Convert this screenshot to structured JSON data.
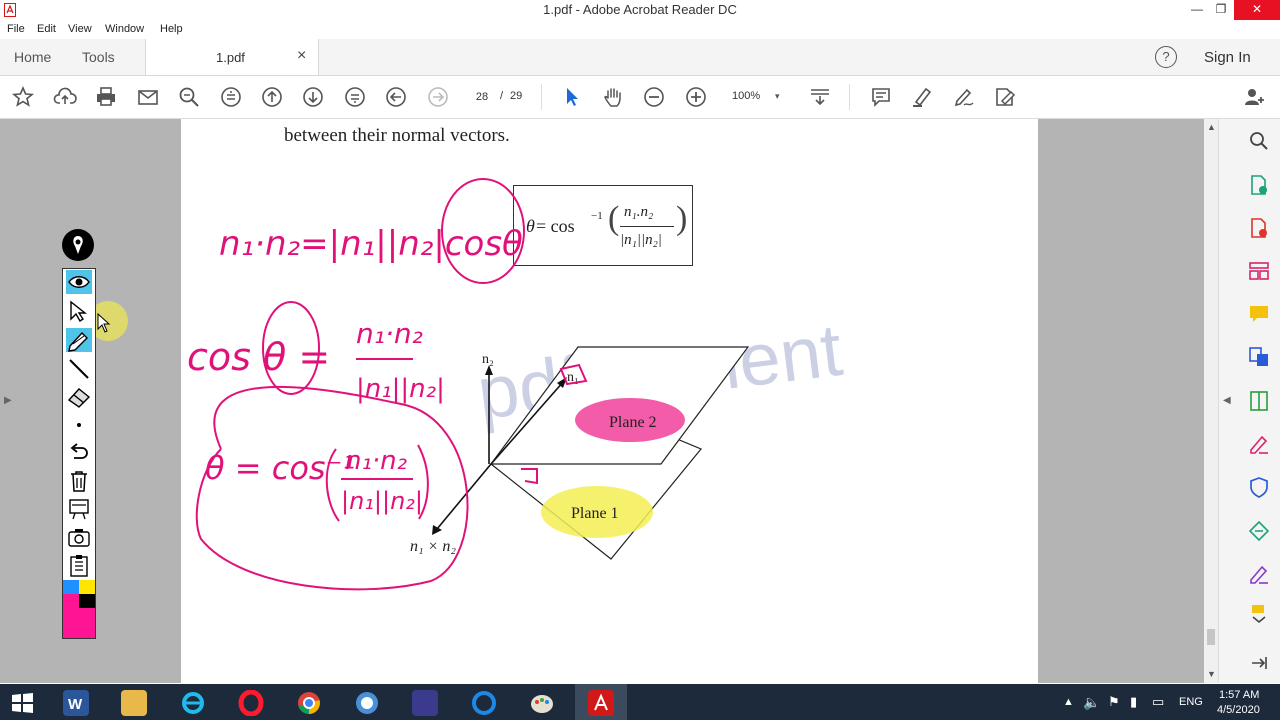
{
  "window": {
    "title": "1.pdf - Adobe Acrobat Reader DC",
    "minimize": "—",
    "restore": "❐",
    "close": "✕"
  },
  "menu": [
    "File",
    "Edit",
    "View",
    "Window",
    "Help"
  ],
  "tabs": {
    "home": "Home",
    "tools": "Tools",
    "document": "1.pdf",
    "close_glyph": "×",
    "help_glyph": "?",
    "sign_in": "Sign In"
  },
  "toolbar": {
    "page_current": "28",
    "page_separator": "/",
    "page_total": "29",
    "zoom": "100%",
    "icons": [
      "star-icon",
      "upload-icon",
      "print-icon",
      "mail-icon",
      "search-zoom-icon",
      "scroll-up-icon",
      "arrow-up-icon",
      "arrow-down-icon",
      "scroll-down-icon",
      "arrow-left-icon",
      "arrow-right-icon",
      "select-cursor-icon",
      "hand-icon",
      "zoom-out-icon",
      "zoom-in-icon",
      "page-display-icon",
      "comment-icon",
      "highlight-icon",
      "sign-icon",
      "fill-sign-icon",
      "share-user-icon"
    ]
  },
  "document": {
    "text_line": "between their normal vectors.",
    "formula": {
      "theta": "θ",
      "equals_cos": " = cos",
      "inverse": "−1",
      "numerator": "n₁.n₂",
      "denominator": "|n₁||n₂|"
    },
    "diagram": {
      "n2_label": "n₂",
      "n1_label": "n₁",
      "cross_label": "n₁ × n₂",
      "plane2": "Plane 2",
      "plane1": "Plane 1",
      "watermark": "pdfelement"
    },
    "handwriting": {
      "line1": "n₁·n₂=|n₁||n₂|cosθ",
      "line2": "cos θ =",
      "fraction_num": "n₁·n₂",
      "fraction_den": "|n₁||n₂|",
      "line3": "θ = cos⁻¹",
      "accent_color": "#e0127a"
    }
  },
  "pen_toolbar": {
    "colors": [
      "#1e90ff",
      "#ffe600",
      "#ff1493",
      "#000000"
    ],
    "tools": [
      "pen-logo-icon",
      "eye-icon",
      "arrow-pointer-icon",
      "pencil-icon",
      "line-icon",
      "eraser-icon",
      "dot-icon",
      "undo-icon",
      "trash-icon",
      "whiteboard-icon",
      "camera-icon",
      "clipboard-icon"
    ]
  },
  "right_panel": [
    "search-icon",
    "export-pdf-icon",
    "create-pdf-icon",
    "organize-icon",
    "comment-tool-icon",
    "combine-icon",
    "compress-icon",
    "edit-icon",
    "protect-icon",
    "convert-icon",
    "fill-sign-tool-icon",
    "more-tools-icon"
  ],
  "taskbar": {
    "apps": [
      "windows-start-icon",
      "word-icon",
      "explorer-icon",
      "ie-icon",
      "opera-icon",
      "chrome-icon",
      "app-icon",
      "teams-icon",
      "cortana-icon",
      "paint-icon",
      "acrobat-icon"
    ],
    "language": "ENG",
    "time": "1:57 AM",
    "date": "4/5/2020"
  }
}
